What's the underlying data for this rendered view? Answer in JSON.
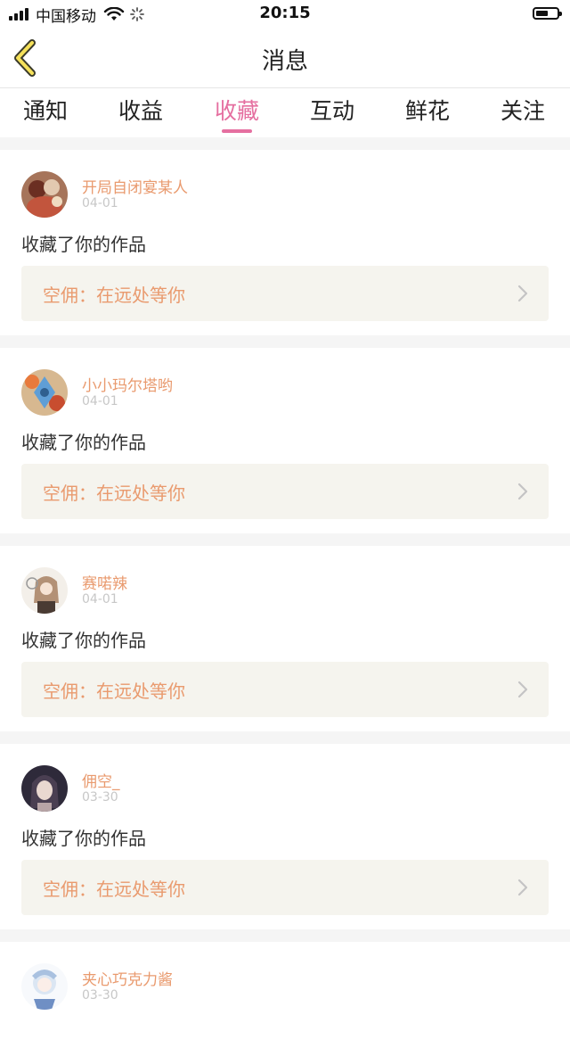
{
  "status_bar": {
    "carrier": "中国移动",
    "time": "20:15",
    "icons": [
      "signal-icon",
      "wifi-icon",
      "loading-icon",
      "battery-icon"
    ]
  },
  "nav": {
    "title": "消息",
    "back_icon": "chevron-left-icon"
  },
  "tabs": [
    {
      "label": "通知"
    },
    {
      "label": "收益"
    },
    {
      "label": "收藏"
    },
    {
      "label": "互动"
    },
    {
      "label": "鲜花"
    },
    {
      "label": "关注"
    }
  ],
  "active_tab": "收藏",
  "colors": {
    "accent_pink": "#e56fa0",
    "username_orange": "#e99a6e",
    "work_box_bg": "#f5f4ee",
    "page_bg": "#f5f5f5"
  },
  "items": [
    {
      "username": "开局自闭宴某人",
      "date": "04-01",
      "action": "收藏了你的作品",
      "work": "空佣：在远处等你"
    },
    {
      "username": "小小玛尔塔哟",
      "date": "04-01",
      "action": "收藏了你的作品",
      "work": "空佣：在远处等你"
    },
    {
      "username": "赛喏辣",
      "date": "04-01",
      "action": "收藏了你的作品",
      "work": "空佣：在远处等你"
    },
    {
      "username": "佣空_",
      "date": "03-30",
      "action": "收藏了你的作品",
      "work": "空佣：在远处等你"
    },
    {
      "username": "夹心巧克力酱",
      "date": "03-30",
      "action": "",
      "work": ""
    }
  ]
}
